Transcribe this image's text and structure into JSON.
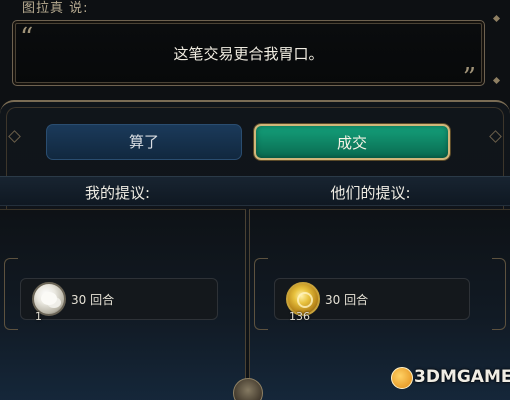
{
  "speech": {
    "speaker": "图拉真 说:",
    "open_quote": "“",
    "close_quote": "”",
    "text": "这笔交易更合我胃口。"
  },
  "buttons": {
    "cancel_label": "算了",
    "accept_label": "成交"
  },
  "offers": {
    "mine_label": "我的提议:",
    "theirs_label": "他们的提议:",
    "mine_items": [
      {
        "icon": "cotton-icon",
        "quantity": "1",
        "duration": "30 回合"
      }
    ],
    "theirs_items": [
      {
        "icon": "gold-coin-icon",
        "quantity": "136",
        "duration": "30 回合"
      }
    ]
  },
  "colors": {
    "accept_green": "#0f8a66",
    "cancel_blue": "#163352",
    "frame_gold": "#7a6c54"
  },
  "watermark": {
    "text": "3DMGAME"
  }
}
